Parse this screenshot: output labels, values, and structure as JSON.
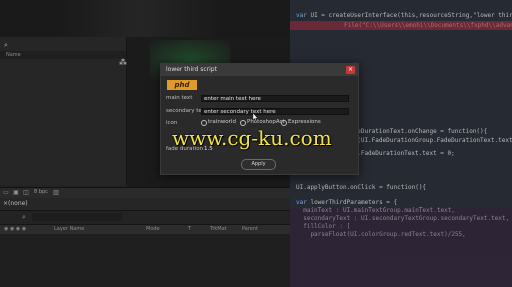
{
  "left_app": {
    "project_panel": {
      "search_icon": "search-icon",
      "column_name": "Name",
      "flow_icon": "flowchart-icon"
    },
    "toolbar": {
      "icons": [
        "folder-icon",
        "comp-icon",
        "depth-icon",
        "trash-icon"
      ],
      "bpc": "8 bpc"
    },
    "timeline": {
      "close": "×",
      "comp_name": "(none)",
      "columns": [
        "Layer Name",
        "Mode",
        "T",
        "TrkMat",
        "Parent"
      ]
    }
  },
  "dialog": {
    "title": "lower third script",
    "logo": "phd",
    "fields": [
      {
        "label": "main text",
        "value": "enter main text here"
      },
      {
        "label": "secondary text",
        "value": "enter secondary text here"
      }
    ],
    "icon_label": "icon",
    "radio_options": [
      {
        "label": "trainworld",
        "selected": false
      },
      {
        "label": "PhotoshopAct",
        "selected": false
      },
      {
        "label": "Expressions",
        "selected": false
      }
    ],
    "fade_label": "fade duration",
    "fade_value": "1.5",
    "apply_label": "Apply"
  },
  "code": {
    "lines": [
      {
        "parts": [
          [
            "plain",
            "lower third script\");"
          ]
        ]
      },
      {
        "parts": [
          [
            "kw",
            "var "
          ],
          [
            "plain",
            "UI = createUserInterface(this,resourceString,\"lower third script\");"
          ]
        ]
      },
      {
        "parts": [
          [
            "plain",
            "File(\"C:\\\\Users\\\\emohi\\\\Documents\\\\fxphd\\\\advanced sc"
          ]
        ]
      },
      {
        "parts": [
          [
            "plain",
            "adeDurationText.onChange = function(){"
          ]
        ]
      },
      {
        "parts": [
          [
            "plain",
            "at(UI.FadeDurationGroup.FadeDurationText.text);"
          ]
        ]
      },
      {
        "parts": [
          [
            "plain",
            "up.FadeDurationText.text = 0;"
          ]
        ]
      },
      {
        "parts": [
          [
            "plain",
            "UI.applyButton.onClick = function(){"
          ]
        ]
      },
      {
        "parts": [
          [
            "kw",
            "var "
          ],
          [
            "plain",
            "lowerThirdParameters = {"
          ]
        ]
      },
      {
        "parts": [
          [
            "plain",
            "  mainText : UI.mainTextGroup.mainText.text,"
          ]
        ]
      },
      {
        "parts": [
          [
            "plain",
            "  secondaryText : UI.secondaryTextGroup.secondaryText.text,"
          ]
        ]
      },
      {
        "parts": [
          [
            "plain",
            "  fillColor : ["
          ]
        ]
      },
      {
        "parts": [
          [
            "plain",
            "    parseFloat(UI.colorGroup.redText.text)/255,"
          ]
        ]
      }
    ]
  },
  "watermark": "www.cg-ku.com"
}
